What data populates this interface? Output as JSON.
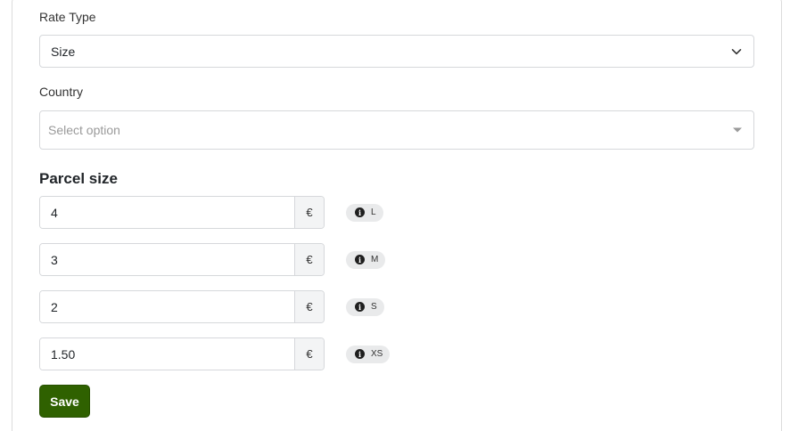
{
  "form": {
    "rate_type": {
      "label": "Rate Type",
      "value": "Size"
    },
    "country": {
      "label": "Country",
      "placeholder": "Select option"
    },
    "parcel_section": {
      "title": "Parcel size"
    },
    "parcel_rates": [
      {
        "value": "4",
        "currency": "€",
        "size": "L"
      },
      {
        "value": "3",
        "currency": "€",
        "size": "M"
      },
      {
        "value": "2",
        "currency": "€",
        "size": "S"
      },
      {
        "value": "1.50",
        "currency": "€",
        "size": "XS"
      }
    ],
    "save_label": "Save"
  },
  "icons": {
    "rate_type_toggle": "chevron-down-icon",
    "country_toggle": "caret-down-icon",
    "size_info": "info-circle-icon"
  },
  "colors": {
    "save_button": "#2f6100",
    "badge_bg": "#e9eaeb",
    "addon_bg": "#f3f4f5",
    "border": "#d6d8db"
  }
}
